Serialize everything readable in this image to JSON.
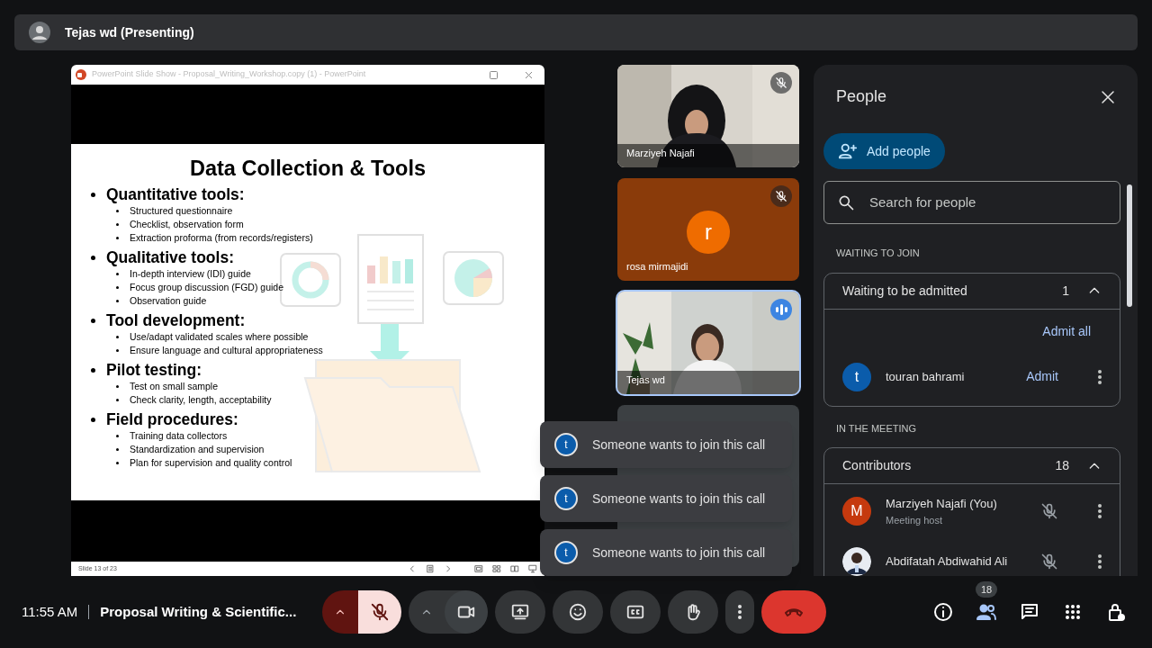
{
  "presenting_bar": {
    "name": "Tejas wd (Presenting)"
  },
  "slideshow_window": {
    "title": "PowerPoint Slide Show  -  Proposal_Writing_Workshop.copy (1) - PowerPoint",
    "slide": {
      "title": "Data Collection & Tools",
      "sections": [
        {
          "heading": "Quantitative tools:",
          "bullets": [
            "Structured questionnaire",
            "Checklist, observation form",
            "Extraction proforma (from records/registers)"
          ]
        },
        {
          "heading": "Qualitative tools:",
          "bullets": [
            "In-depth interview (IDI) guide",
            "Focus group discussion (FGD) guide",
            "Observation guide"
          ]
        },
        {
          "heading": "Tool development:",
          "bullets": [
            "Use/adapt validated scales where possible",
            "Ensure language and cultural appropriateness"
          ]
        },
        {
          "heading": "Pilot testing:",
          "bullets": [
            "Test on small sample",
            "Check clarity, length, acceptability"
          ]
        },
        {
          "heading": "Field procedures:",
          "bullets": [
            "Training data collectors",
            "Standardization and supervision",
            "Plan for supervision and quality control"
          ]
        }
      ]
    },
    "status": "Slide 13 of 23"
  },
  "tiles": [
    {
      "kind": "video",
      "name": "Marziyeh Najafi",
      "muted": true,
      "speaking": false,
      "selected": false
    },
    {
      "kind": "avatar",
      "initial": "r",
      "name": "rosa mirmajidi",
      "muted": true,
      "speaking": false,
      "color": "#ef6c00",
      "selected": false
    },
    {
      "kind": "video",
      "name": "Tejas wd",
      "muted": false,
      "speaking": true,
      "selected": true
    },
    {
      "kind": "more"
    }
  ],
  "toasts": [
    {
      "initial": "t",
      "text": "Someone wants to join this call"
    },
    {
      "initial": "t",
      "text": "Someone wants to join this call"
    },
    {
      "initial": "t",
      "text": "Someone wants to join this call"
    }
  ],
  "people_panel": {
    "title": "People",
    "add_button": "Add people",
    "search_placeholder": "Search for people",
    "waiting": {
      "section_label": "WAITING TO JOIN",
      "group_title": "Waiting to be admitted",
      "count": "1",
      "expanded": true,
      "admit_all": "Admit all",
      "people": [
        {
          "initial": "t",
          "name": "touran bahrami",
          "action": "Admit",
          "color": "#0b5cab"
        }
      ]
    },
    "meeting": {
      "section_label": "IN THE MEETING",
      "group_title": "Contributors",
      "count": "18",
      "expanded": true,
      "people": [
        {
          "kind": "initial",
          "initial": "M",
          "name": "Marziyeh Najafi (You)",
          "role": "Meeting host",
          "color": "#c5390e",
          "muted": true
        },
        {
          "name": "Abdifatah Abdiwahid Ali",
          "muted": true
        }
      ]
    }
  },
  "bottom_bar": {
    "time": "11:55 AM",
    "meeting_title": "Proposal Writing & Scientific...",
    "mic_muted": true,
    "people_count": "18"
  }
}
